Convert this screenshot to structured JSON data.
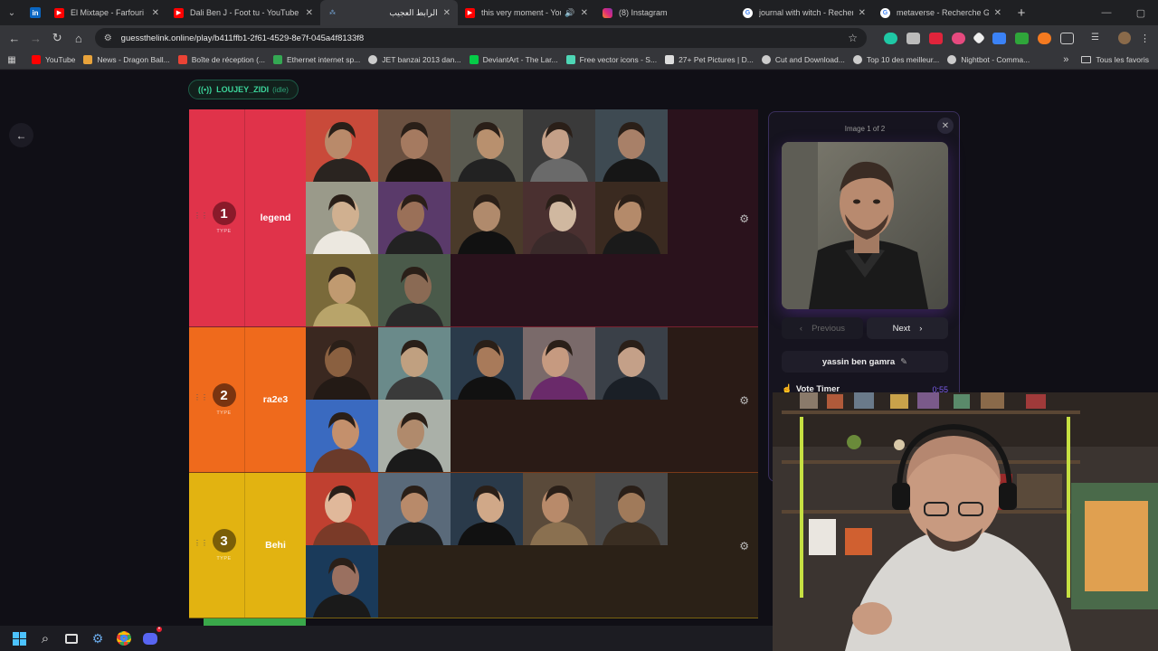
{
  "browser": {
    "tabs": [
      {
        "title": "El Mixtape - Farfouri - YouTube",
        "favicon": "youtube-icon",
        "active": false
      },
      {
        "title": "Dali Ben J - Foot tu - YouTube",
        "favicon": "youtube-icon",
        "active": false
      },
      {
        "title": "الرابط العجيب",
        "favicon": "guessthelink-icon",
        "active": true
      },
      {
        "title": "this very moment - YouTube",
        "favicon": "youtube-icon",
        "active": false
      },
      {
        "title": "(8) Instagram",
        "favicon": "instagram-icon",
        "active": false
      },
      {
        "title": "journal with witch - Recherche",
        "favicon": "google-icon",
        "active": false
      },
      {
        "title": "metaverse - Recherche Google",
        "favicon": "google-icon",
        "active": false
      }
    ],
    "url": "guessthelink.online/play/b411ffb1-2f61-4529-8e7f-045a4f8133f8",
    "bookmarks": [
      {
        "label": "YouTube",
        "color": "#ff0000"
      },
      {
        "label": "News - Dragon Ball...",
        "color": "#e8a33b"
      },
      {
        "label": "Boîte de réception (...",
        "color": "#ea4335"
      },
      {
        "label": "Ethernet internet sp...",
        "color": "#34a853"
      },
      {
        "label": "JET banzai 2013 dan...",
        "color": "#cccccc"
      },
      {
        "label": "DeviantArt - The Lar...",
        "color": "#05cc47"
      },
      {
        "label": "Free vector icons - S...",
        "color": "#4ed6b5"
      },
      {
        "label": "27+ Pet Pictures | D...",
        "color": "#dddddd"
      },
      {
        "label": "Cut and Download...",
        "color": "#cccccc"
      },
      {
        "label": "Top 10 des meilleur...",
        "color": "#cccccc"
      },
      {
        "label": "Nightbot - Comma...",
        "color": "#cccccc"
      }
    ],
    "all_bookmarks": "Tous les favoris"
  },
  "player": {
    "username": "LOUJEY_ZIDI",
    "status": "(idle)"
  },
  "tiers": [
    {
      "rank": "1",
      "type_label": "TYPE",
      "name": "legend",
      "color": "#e0334a",
      "badge_color": "#8a1a2a",
      "area_color": "#2a121c",
      "item_count": 12
    },
    {
      "rank": "2",
      "type_label": "TYPE",
      "name": "ra2e3",
      "color": "#ef6a1c",
      "badge_color": "#7a3410",
      "area_color": "#2a1b16",
      "item_count": 7
    },
    {
      "rank": "3",
      "type_label": "TYPE",
      "name": "Behi",
      "color": "#e2b311",
      "badge_color": "#7a5e08",
      "area_color": "#2b2117",
      "item_count": 6
    }
  ],
  "panel": {
    "counter": "Image 1 of 2",
    "prev_label": "Previous",
    "next_label": "Next",
    "answer": "yassin ben gamra",
    "vote_label": "Vote Timer",
    "vote_time": "0:55"
  }
}
